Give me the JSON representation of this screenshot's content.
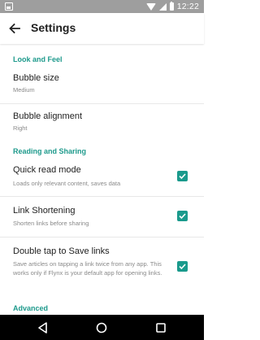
{
  "status_bar": {
    "time": "12:22"
  },
  "app_bar": {
    "title": "Settings"
  },
  "sections": {
    "look_and_feel": "Look and Feel",
    "reading_and_sharing": "Reading and Sharing",
    "advanced": "Advanced"
  },
  "items": {
    "bubble_size": {
      "title": "Bubble size",
      "value": "Medium"
    },
    "bubble_alignment": {
      "title": "Bubble alignment",
      "value": "Right"
    },
    "quick_read": {
      "title": "Quick read mode",
      "summary": "Loads only relevant content, saves data",
      "checked": true
    },
    "link_shortening": {
      "title": "Link Shortening",
      "summary": "Shorten links before sharing",
      "checked": true
    },
    "double_tap": {
      "title": "Double tap to Save links",
      "summary": "Save articles on tapping a link twice from any app. This works only if Flynx is your default app for opening links.",
      "checked": true
    }
  },
  "colors": {
    "accent": "#1a9a8c",
    "status_bar": "#9e9e9e",
    "nav_bar": "#000000"
  }
}
